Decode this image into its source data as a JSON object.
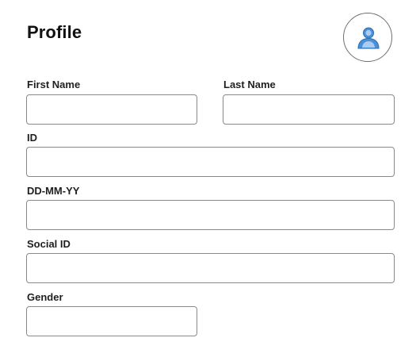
{
  "header": {
    "title": "Profile",
    "avatar_icon": "user-avatar-icon"
  },
  "form": {
    "first_name": {
      "label": "First Name",
      "value": "",
      "placeholder": ""
    },
    "last_name": {
      "label": "Last Name",
      "value": "",
      "placeholder": ""
    },
    "id": {
      "label": "ID",
      "value": "",
      "placeholder": ""
    },
    "dob": {
      "label": "DD-MM-YY",
      "value": "",
      "placeholder": ""
    },
    "social_id": {
      "label": "Social ID",
      "value": "",
      "placeholder": ""
    },
    "gender": {
      "label": "Gender",
      "value": "",
      "placeholder": ""
    }
  },
  "colors": {
    "avatar_fill": "#4a90d9",
    "avatar_light": "#a9cdf2",
    "border": "#8a8a8a"
  }
}
